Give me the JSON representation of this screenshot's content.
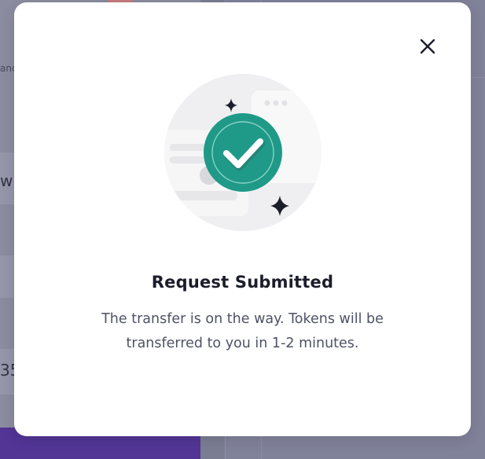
{
  "background": {
    "partial_text_1": "anc",
    "partial_text_2": "wn",
    "partial_text_3": "35"
  },
  "modal": {
    "close_icon": "close-icon",
    "illustration_icon": "success-check-icon",
    "title": "Request Submitted",
    "message": "The transfer is on the way. Tokens will be transferred to you in 1-2 minutes."
  },
  "colors": {
    "accent": "#1f9a88",
    "accent_dark": "#168474",
    "overlay": "#7d7f95",
    "background_purple": "#523595",
    "title_text": "#1c1d2b",
    "body_text": "#4f5266"
  }
}
